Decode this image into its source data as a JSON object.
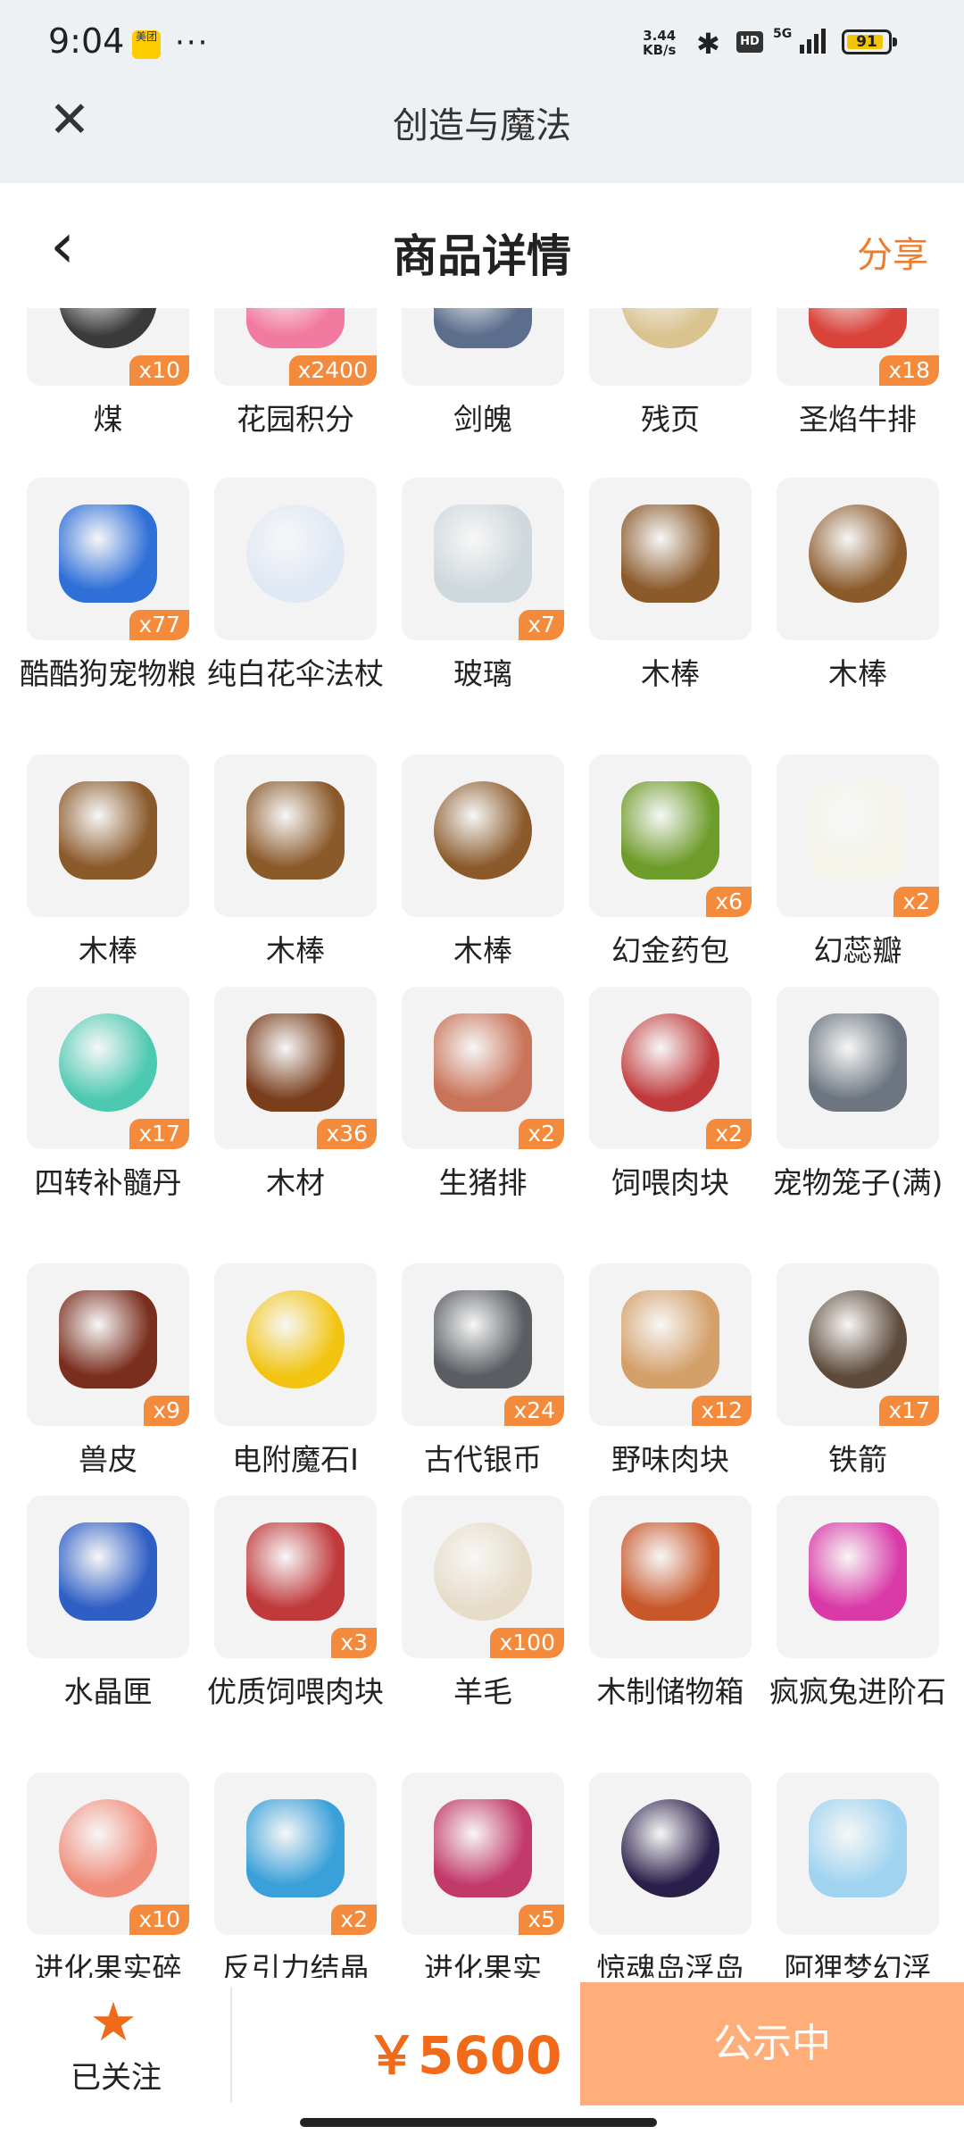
{
  "status_bar": {
    "time": "9:04",
    "app_badge": "美团",
    "more": "···",
    "network_speed": "3.44\nKB/s",
    "hd": "HD",
    "signal": "5G",
    "battery": "91"
  },
  "app_header": {
    "close_icon": "close-icon",
    "title": "创造与魔法"
  },
  "nav": {
    "back_icon": "chevron-left-icon",
    "title": "商品详情",
    "share_label": "分享"
  },
  "items": [
    {
      "name": "煤",
      "qty": "x10",
      "icon": "coal-icon",
      "color": "#3a3a3a"
    },
    {
      "name": "花园积分",
      "qty": "x2400",
      "icon": "flower-badge-icon",
      "color": "#f27aa0"
    },
    {
      "name": "剑魄",
      "qty": "",
      "icon": "sword-spirit-icon",
      "color": "#5b6e8c"
    },
    {
      "name": "残页",
      "qty": "",
      "icon": "torn-page-icon",
      "color": "#d9c38f"
    },
    {
      "name": "圣焰牛排",
      "qty": "x18",
      "icon": "steak-icon",
      "color": "#d9433a"
    },
    {
      "name": "酷酷狗宠物粮",
      "qty": "x77",
      "icon": "pet-food-bag-icon",
      "color": "#2e6fd8"
    },
    {
      "name": "纯白花伞法杖",
      "qty": "",
      "icon": "umbrella-staff-icon",
      "color": "#dfe8f4"
    },
    {
      "name": "玻璃",
      "qty": "x7",
      "icon": "glass-icon",
      "color": "#cfd8dc"
    },
    {
      "name": "木棒",
      "qty": "",
      "icon": "wooden-club-icon",
      "color": "#8b5a2b"
    },
    {
      "name": "木棒",
      "qty": "",
      "icon": "wooden-club-icon",
      "color": "#8b5a2b"
    },
    {
      "name": "木棒",
      "qty": "",
      "icon": "wooden-club-icon",
      "color": "#8b5a2b"
    },
    {
      "name": "木棒",
      "qty": "",
      "icon": "wooden-club-icon",
      "color": "#8b5a2b"
    },
    {
      "name": "木棒",
      "qty": "",
      "icon": "wooden-club-icon",
      "color": "#8b5a2b"
    },
    {
      "name": "幻金药包",
      "qty": "x6",
      "icon": "medicine-pouch-icon",
      "color": "#6e9c2a"
    },
    {
      "name": "幻蕊瓣",
      "qty": "x2",
      "icon": "petal-icon",
      "color": "#f4f4ea"
    },
    {
      "name": "四转补髓丹",
      "qty": "x17",
      "icon": "potion-flask-icon",
      "color": "#4cc9b0"
    },
    {
      "name": "木材",
      "qty": "x36",
      "icon": "log-icon",
      "color": "#7a3e1d"
    },
    {
      "name": "生猪排",
      "qty": "x2",
      "icon": "pork-chop-icon",
      "color": "#c9745a"
    },
    {
      "name": "饲喂肉块",
      "qty": "x2",
      "icon": "meat-block-icon",
      "color": "#c0393b"
    },
    {
      "name": "宠物笼子(满)",
      "qty": "",
      "icon": "pet-cage-icon",
      "color": "#6d7680"
    },
    {
      "name": "兽皮",
      "qty": "x9",
      "icon": "animal-hide-icon",
      "color": "#7a2e1e"
    },
    {
      "name": "电附魔石I",
      "qty": "",
      "icon": "yellow-crystal-icon",
      "color": "#f2c40f"
    },
    {
      "name": "古代银币",
      "qty": "x24",
      "icon": "silver-coin-icon",
      "color": "#5a5e63"
    },
    {
      "name": "野味肉块",
      "qty": "x12",
      "icon": "meat-tray-icon",
      "color": "#d4a06a"
    },
    {
      "name": "铁箭",
      "qty": "x17",
      "icon": "iron-arrow-icon",
      "color": "#5d4a3a"
    },
    {
      "name": "水晶匣",
      "qty": "",
      "icon": "crystal-chest-icon",
      "color": "#2f5fc4"
    },
    {
      "name": "优质饲喂肉块",
      "qty": "x3",
      "icon": "meat-block-icon",
      "color": "#c0393b"
    },
    {
      "name": "羊毛",
      "qty": "x100",
      "icon": "wool-icon",
      "color": "#e6dcc8"
    },
    {
      "name": "木制储物箱",
      "qty": "",
      "icon": "wooden-crate-icon",
      "color": "#c8582a"
    },
    {
      "name": "疯疯兔进阶石",
      "qty": "",
      "icon": "rabbit-gem-icon",
      "color": "#d93aa8"
    },
    {
      "name": "进化果实碎",
      "qty": "x10",
      "icon": "fruit-fragment-icon",
      "color": "#f08c7a"
    },
    {
      "name": "反引力结晶",
      "qty": "x2",
      "icon": "antigravity-crystal-icon",
      "color": "#3aa0d9"
    },
    {
      "name": "进化果实",
      "qty": "x5",
      "icon": "evolution-fruit-icon",
      "color": "#c23a6a"
    },
    {
      "name": "惊魂岛浮岛",
      "qty": "",
      "icon": "floating-island-icon",
      "color": "#2a1f4a"
    },
    {
      "name": "阿狸梦幻浮",
      "qty": "",
      "icon": "dream-cloud-icon",
      "color": "#9fd3f0"
    }
  ],
  "bottom_bar": {
    "follow_icon": "star-icon",
    "follow_label": "已关注",
    "price": "￥5600",
    "status_button": "公示中"
  }
}
